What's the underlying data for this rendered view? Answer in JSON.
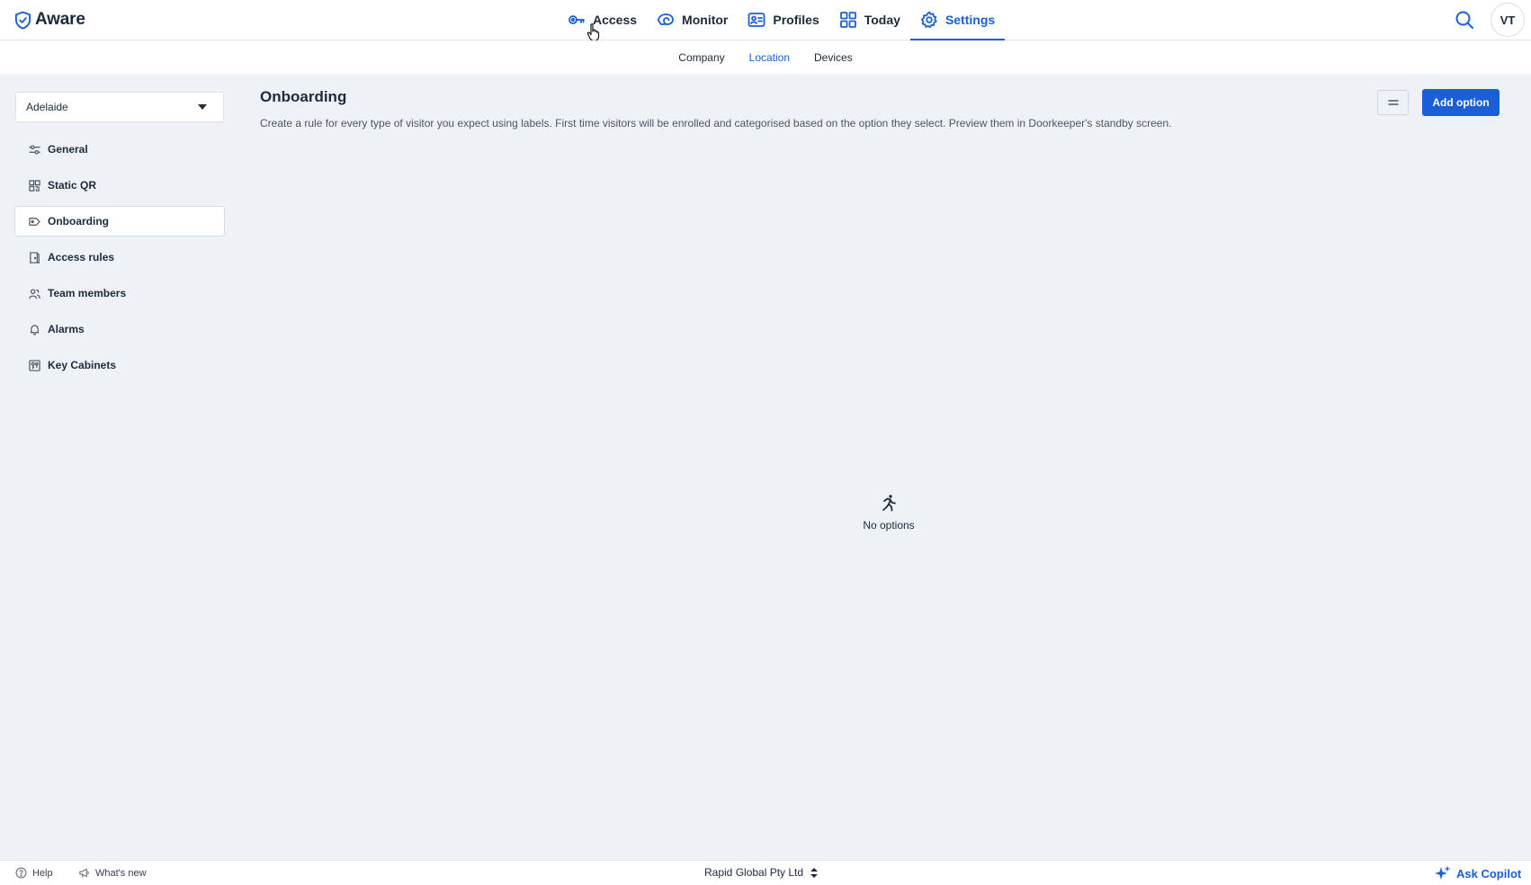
{
  "app": {
    "name": "Aware"
  },
  "header": {
    "nav": [
      {
        "label": "Access",
        "icon": "key-icon"
      },
      {
        "label": "Monitor",
        "icon": "monitor-icon"
      },
      {
        "label": "Profiles",
        "icon": "profile-card-icon"
      },
      {
        "label": "Today",
        "icon": "grid-icon"
      },
      {
        "label": "Settings",
        "icon": "gear-icon",
        "active": true
      }
    ],
    "avatar_initials": "VT"
  },
  "subnav": {
    "tabs": [
      {
        "label": "Company"
      },
      {
        "label": "Location",
        "active": true
      },
      {
        "label": "Devices"
      }
    ]
  },
  "sidebar": {
    "location": "Adelaide",
    "items": [
      {
        "label": "General",
        "icon": "sliders-icon"
      },
      {
        "label": "Static QR",
        "icon": "qr-icon"
      },
      {
        "label": "Onboarding",
        "icon": "tag-icon",
        "active": true
      },
      {
        "label": "Access rules",
        "icon": "door-icon"
      },
      {
        "label": "Team members",
        "icon": "users-icon"
      },
      {
        "label": "Alarms",
        "icon": "bell-icon"
      },
      {
        "label": "Key Cabinets",
        "icon": "key-cabinet-icon"
      }
    ]
  },
  "main": {
    "title": "Onboarding",
    "description": "Create a rule for every type of visitor you expect using labels. First time visitors will be enrolled and categorised based on the option they select. Preview them in Doorkeeper's standby screen.",
    "add_button": "Add option",
    "empty_text": "No options"
  },
  "footer": {
    "help": "Help",
    "whats_new": "What's new",
    "organisation": "Rapid Global Pty Ltd",
    "copilot": "Ask Copilot"
  },
  "colors": {
    "accent": "#1a5fd6",
    "background": "#eef2f6",
    "text": "#1e2b3c"
  }
}
